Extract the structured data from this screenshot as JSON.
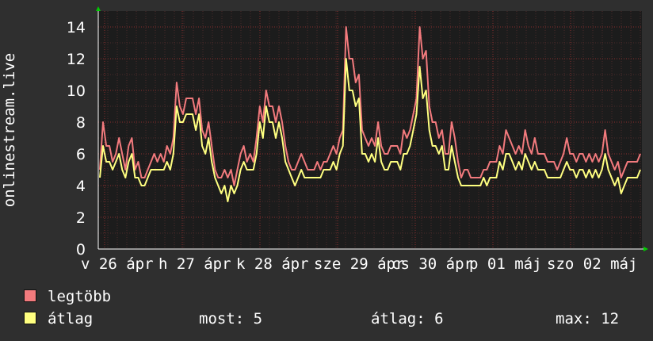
{
  "chart_data": {
    "type": "line",
    "ylabel": "onlinestream.live",
    "ylim": [
      0,
      15
    ],
    "yticks": [
      0,
      2,
      4,
      6,
      8,
      10,
      12,
      14
    ],
    "xticks": [
      "v 26 ápr",
      "h 27 ápr",
      "k 28 ápr",
      "sze 29 ápr",
      "cs 30 ápr",
      "p 01 máj",
      "szo 02 máj"
    ],
    "grid": true,
    "legend_position": "bottom-left",
    "series": [
      {
        "name": "legtöbb",
        "color": "#f27a7d",
        "values": [
          5,
          8,
          6.5,
          6.5,
          5.5,
          6,
          7,
          6,
          5,
          6.5,
          7,
          5,
          5.5,
          4.5,
          4.5,
          5,
          5.5,
          6,
          5.5,
          6,
          5.5,
          6.5,
          6,
          7,
          10.5,
          9,
          8.5,
          9.5,
          9.5,
          9.5,
          8.5,
          9.5,
          7.5,
          7,
          8,
          6.5,
          5,
          4.5,
          4.5,
          5,
          4.5,
          5,
          4,
          5,
          6,
          6.5,
          5.5,
          6,
          5.5,
          7,
          9,
          8,
          10,
          9,
          9,
          8,
          9,
          8,
          6.5,
          5.5,
          5,
          5,
          5.5,
          6,
          5.5,
          5,
          5,
          5,
          5.5,
          5,
          5.5,
          5.5,
          6,
          6.5,
          6,
          7,
          7.5,
          14,
          12,
          12,
          10.5,
          11,
          7.5,
          7,
          6.5,
          7,
          6.5,
          8,
          6.5,
          6,
          6,
          6.5,
          6.5,
          6.5,
          6,
          7.5,
          7,
          7.5,
          8.5,
          9.5,
          14,
          12,
          12.5,
          9,
          8,
          8,
          7,
          7.5,
          6,
          6,
          8,
          7,
          5.5,
          4.5,
          5,
          5,
          4.5,
          4.5,
          4.5,
          4.5,
          5,
          5,
          5.5,
          5.5,
          5.5,
          6.5,
          6,
          7.5,
          7,
          6.5,
          6,
          6.5,
          6,
          7.5,
          6.5,
          6,
          7,
          6,
          6,
          6,
          5.5,
          5.5,
          5.5,
          5,
          5.5,
          6,
          7,
          6,
          6,
          5.5,
          6,
          6,
          5.5,
          6,
          5.5,
          6,
          5.5,
          6,
          7.5,
          6,
          5.5,
          5,
          5.5,
          4.5,
          5,
          5.5,
          5.5,
          5.5,
          5.5,
          6
        ],
        "_width_note": "polyline"
      },
      {
        "name": "átlag",
        "color": "#ffff80",
        "values": [
          4.5,
          6.5,
          5.5,
          5.5,
          5,
          5.5,
          6,
          5,
          4.5,
          5.5,
          6,
          4.5,
          4.5,
          4,
          4,
          4.5,
          5,
          5,
          5,
          5,
          5,
          5.5,
          5,
          6,
          9,
          8,
          8,
          8.5,
          8.5,
          8.5,
          7.5,
          8.5,
          6.5,
          6,
          7,
          5.5,
          4.5,
          4,
          3.5,
          4,
          3,
          4,
          3.5,
          4,
          5,
          5.5,
          5,
          5,
          5,
          6,
          8,
          7,
          9,
          8,
          8,
          7,
          8,
          7,
          5.5,
          5,
          4.5,
          4,
          4.5,
          5,
          4.5,
          4.5,
          4.5,
          4.5,
          4.5,
          4.5,
          5,
          5,
          5,
          5.5,
          5,
          6,
          6.5,
          12,
          10,
          10,
          9,
          9.5,
          6,
          6,
          5.5,
          6,
          5.5,
          7,
          5.5,
          5,
          5,
          5.5,
          5.5,
          5.5,
          5,
          6,
          6,
          6.5,
          7.5,
          8.5,
          11.5,
          9.5,
          10,
          7.5,
          6.5,
          6.5,
          6,
          6.5,
          5,
          5,
          6.5,
          5.5,
          4.5,
          4,
          4,
          4,
          4,
          4,
          4,
          4,
          4.5,
          4,
          4.5,
          4.5,
          4.5,
          5.5,
          5,
          6,
          6,
          5.5,
          5,
          5.5,
          5,
          6,
          5.5,
          5,
          5.5,
          5,
          5,
          5,
          4.5,
          4.5,
          4.5,
          4.5,
          4.5,
          5,
          5.5,
          5,
          5,
          4.5,
          5,
          5,
          4.5,
          5,
          4.5,
          5,
          4.5,
          5,
          6,
          5,
          4.5,
          4,
          4.5,
          3.5,
          4,
          4.5,
          4.5,
          4.5,
          4.5,
          5
        ]
      }
    ]
  },
  "stats": {
    "now": "most: 5",
    "avg": "átlag: 6",
    "max": "max: 12"
  }
}
